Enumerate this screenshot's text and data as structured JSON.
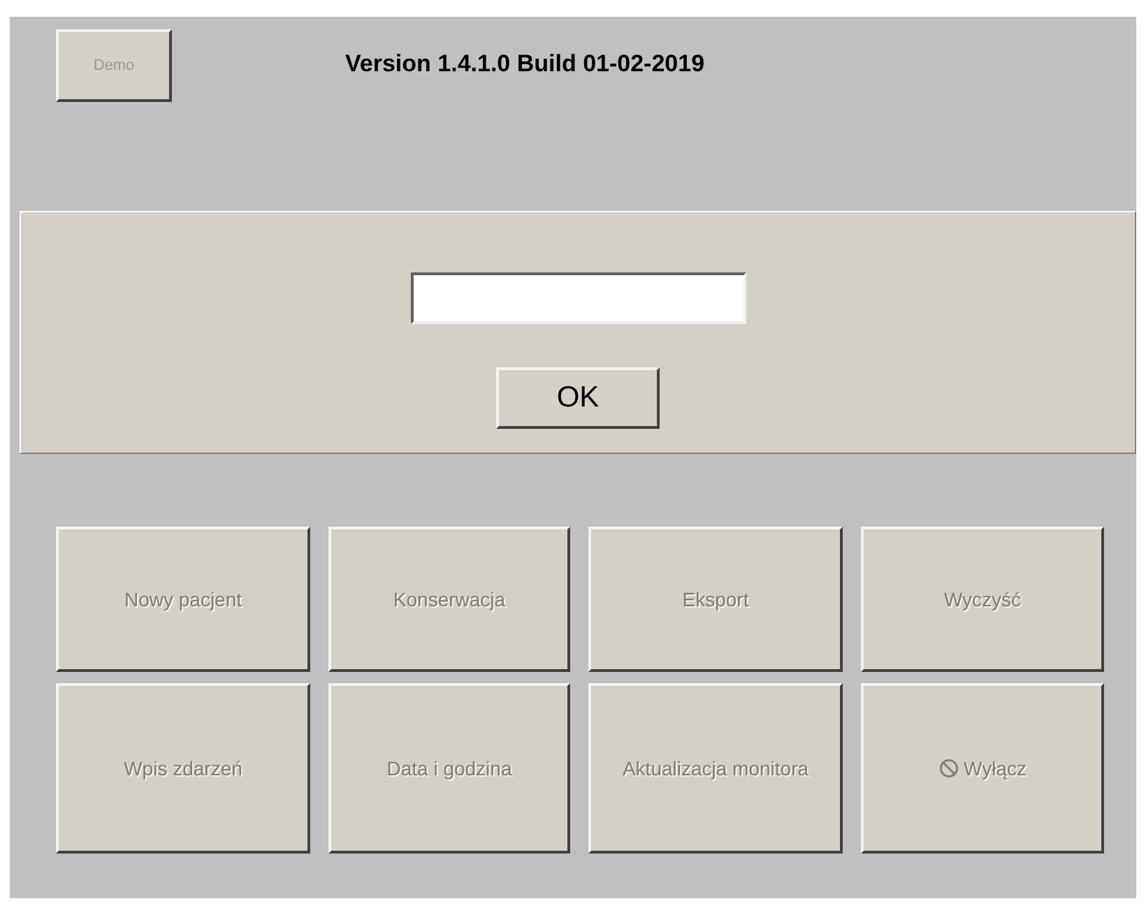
{
  "demo_button": {
    "label": "Demo",
    "disabled": true
  },
  "version": "Version 1.4.1.0 Build 01-02-2019",
  "login": {
    "ok_button": "OK"
  },
  "buttons": [
    {
      "label": "Nowy pacjent",
      "disabled": true,
      "kind": "plain"
    },
    {
      "label": "Konserwacja",
      "disabled": true,
      "kind": "plain"
    },
    {
      "label": "Eksport",
      "disabled": true,
      "kind": "plain"
    },
    {
      "label": "Wyczyść",
      "disabled": true,
      "kind": "plain"
    },
    {
      "label": "Wpis zdarzeń",
      "disabled": true,
      "kind": "plain"
    },
    {
      "label": "Data i godzina",
      "disabled": true,
      "kind": "plain"
    },
    {
      "label": "Aktualizacja monitora",
      "disabled": true,
      "kind": "plain"
    },
    {
      "label": "Wyłącz",
      "disabled": true,
      "kind": "power"
    }
  ]
}
